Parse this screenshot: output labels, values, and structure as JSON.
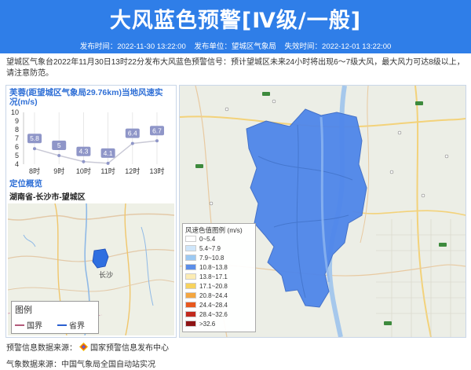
{
  "header": {
    "title": "大风蓝色预警[Ⅳ级/一般]",
    "publish_time_label": "发布时间：2022-11-30 13:22:00",
    "publish_unit_label": "发布单位：望城区气象局",
    "expire_time_label": "失效时间：2022-12-01 13:22:00",
    "color": "#2f7ee8"
  },
  "description": "望城区气象台2022年11月30日13时22分发布大风蓝色预警信号：预计望城区未来24小时将出现6～7级大风，最大风力可达8级以上，请注意防范。",
  "wind_panel": {
    "title": "芙蓉(距望城区气象局29.76km)当地风速实况(m/s)"
  },
  "chart_data": {
    "type": "line",
    "title": "芙蓉(距望城区气象局29.76km)当地风速实况(m/s)",
    "categories": [
      "8时",
      "9时",
      "10时",
      "11时",
      "12时",
      "13时"
    ],
    "values": [
      5.8,
      5,
      4.3,
      4.1,
      6.4,
      6.7
    ],
    "ylim": [
      4,
      10
    ],
    "yticks": [
      4,
      5,
      6,
      7,
      8,
      9,
      10
    ],
    "grid": "vertical",
    "line_color": "#c9c9d6",
    "label_color": "#8f96c8"
  },
  "location": {
    "title": "定位概览",
    "text": "湖南省-长沙市-望城区",
    "map_label": "长沙",
    "legend_title": "图例",
    "legend_items": [
      {
        "label": "国界",
        "color": "#b35a7a"
      },
      {
        "label": "省界",
        "color": "#2a5fd0"
      }
    ]
  },
  "wind_legend": {
    "title": "风速色值图例 (m/s)",
    "items": [
      {
        "label": "0~5.4",
        "color": "#ffffff"
      },
      {
        "label": "5.4~7.9",
        "color": "#cfe6fa"
      },
      {
        "label": "7.9~10.8",
        "color": "#9cc9f2"
      },
      {
        "label": "10.8~13.8",
        "color": "#5c8ee8"
      },
      {
        "label": "13.8~17.1",
        "color": "#fcecb4"
      },
      {
        "label": "17.1~20.8",
        "color": "#f7d35d"
      },
      {
        "label": "20.8~24.4",
        "color": "#f4a640"
      },
      {
        "label": "24.4~28.4",
        "color": "#e8581d"
      },
      {
        "label": "28.4~32.6",
        "color": "#c22a1e"
      },
      {
        "label": ">32.6",
        "color": "#8e1414"
      }
    ]
  },
  "footer": {
    "warning_source_label": "预警信息数据来源：",
    "warning_source_value": "国家预警信息发布中心",
    "weather_source_label": "气象数据来源：",
    "weather_source_value": "中国气象局全国自动站实况"
  }
}
